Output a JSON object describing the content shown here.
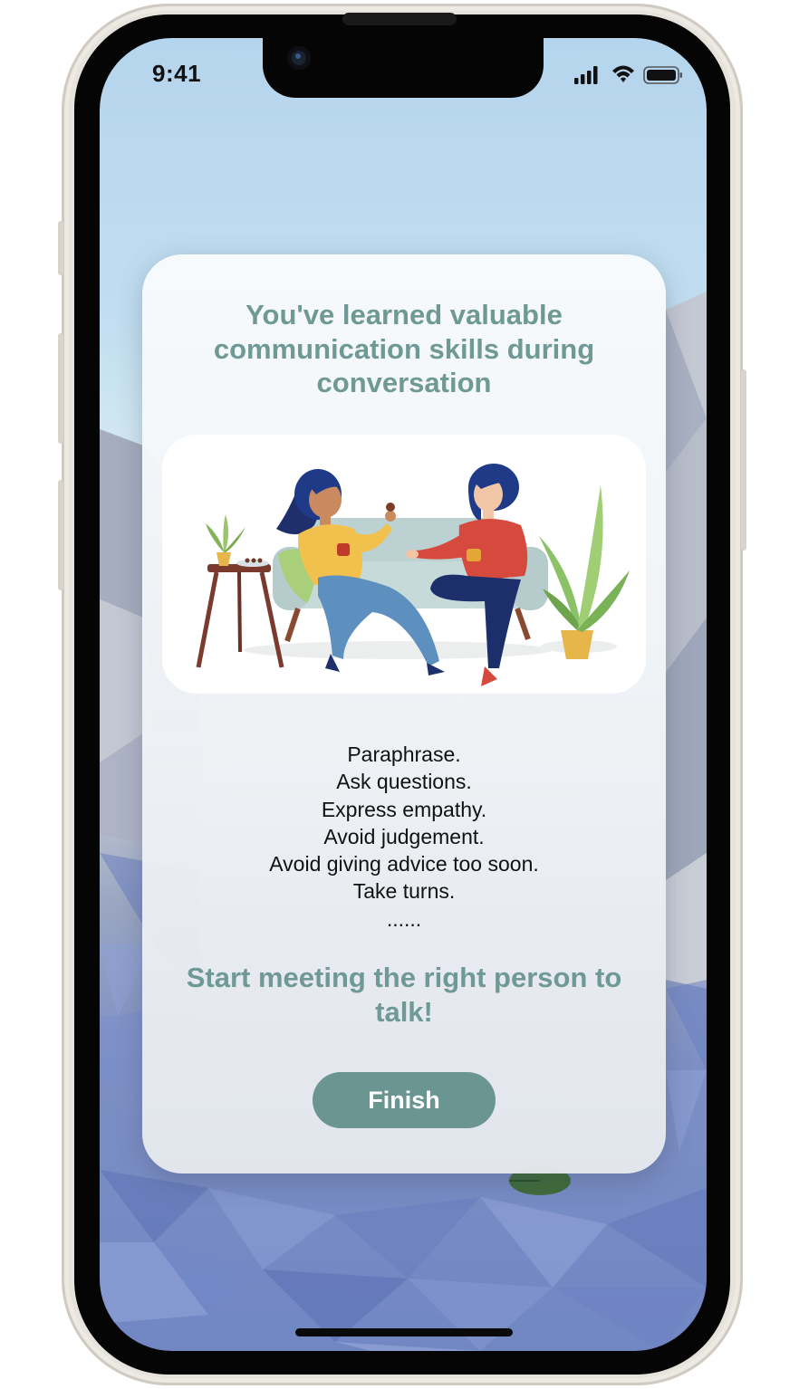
{
  "status_bar": {
    "time": "9:41"
  },
  "card": {
    "headline": "You've learned valuable communication skills during conversation",
    "tips": [
      "Paraphrase.",
      "Ask questions.",
      "Express empathy.",
      "Avoid judgement.",
      "Avoid giving advice too soon.",
      "Take turns.",
      "......"
    ],
    "call_to_action": "Start meeting the right person to talk!",
    "finish_label": "Finish"
  },
  "colors": {
    "accent_text": "#6f9994",
    "button_bg": "#6a9591",
    "button_text": "#ffffff"
  },
  "icons": [
    "cellular-signal-icon",
    "wifi-icon",
    "battery-icon"
  ]
}
